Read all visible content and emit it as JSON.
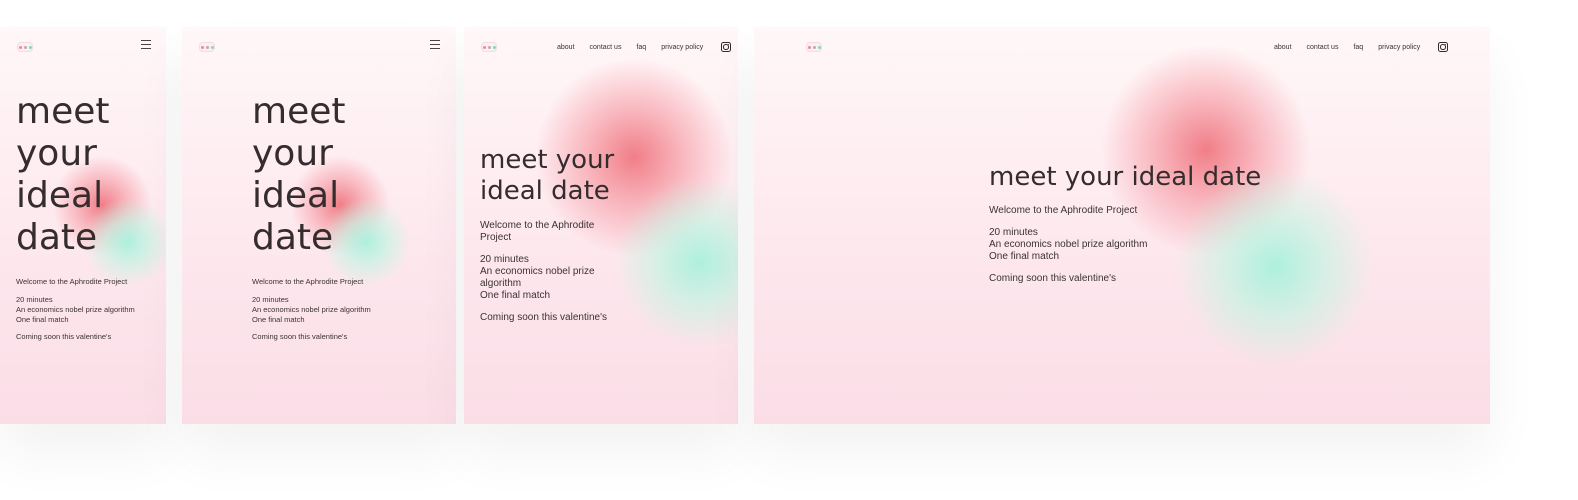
{
  "brand": {
    "logo_icon": "aphrodite-logo-icon",
    "logo_colors": [
      "#f08a96",
      "#b9a9c9",
      "#7fd9bf"
    ]
  },
  "nav": {
    "about": "about",
    "contact": "contact us",
    "faq": "faq",
    "privacy": "privacy policy",
    "menu_icon": "hamburger-menu-icon",
    "social_icon": "instagram-icon"
  },
  "hero": {
    "stacked": [
      "meet",
      "your",
      "ideal",
      "date"
    ],
    "two_line": [
      "meet your",
      "ideal date"
    ],
    "single": "meet your ideal date"
  },
  "body": {
    "welcome": "Welcome to the Aphrodite Project",
    "welcome_wrapped": [
      "Welcome to the Aphrodite",
      "Project"
    ],
    "line1": "20 minutes",
    "line2": "An economics nobel prize algorithm",
    "line2_wrapped": [
      "An economics nobel prize",
      "algorithm"
    ],
    "line3": "One final match",
    "coming": "Coming soon this valentine's"
  },
  "colors": {
    "background_top": "#fff7f8",
    "background_bottom": "#fbdde6",
    "accent_red": "#f07882",
    "accent_mint": "#aaf0dc",
    "text": "#352c2e"
  }
}
